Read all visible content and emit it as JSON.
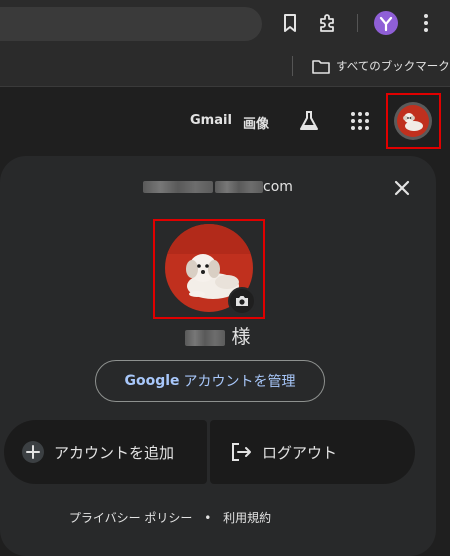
{
  "browser": {
    "bookmarks_label": "すべてのブックマーク"
  },
  "google_bar": {
    "gmail": "Gmail",
    "images": "画像"
  },
  "account_panel": {
    "email_visible_part": "com",
    "name_suffix": "様",
    "manage_brand": "Google",
    "manage_label": "アカウントを管理",
    "add_account": "アカウントを追加",
    "logout": "ログアウト",
    "privacy": "プライバシー ポリシー",
    "separator": "•",
    "terms": "利用規約"
  },
  "colors": {
    "highlight": "#e00000",
    "link_blue": "#a8c7fa",
    "avatar_red": "#c0301e"
  }
}
